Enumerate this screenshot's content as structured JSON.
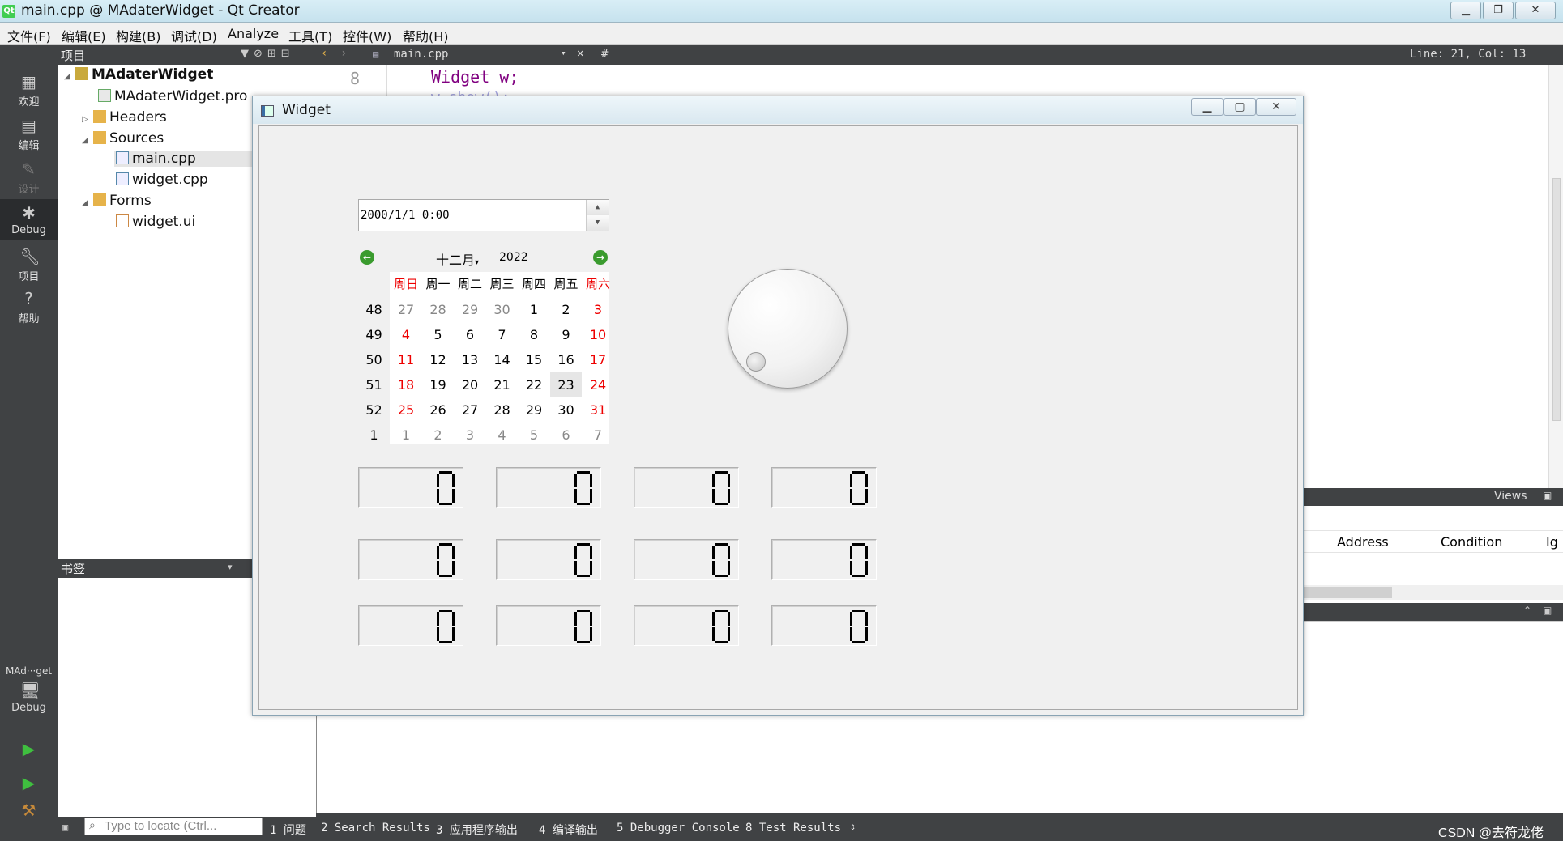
{
  "window": {
    "title": "main.cpp @ MAdaterWidget - Qt Creator",
    "app_icon": "qt-logo-icon"
  },
  "menubar": [
    "文件(F)",
    "编辑(E)",
    "构建(B)",
    "调试(D)",
    "Analyze",
    "工具(T)",
    "控件(W)",
    "帮助(H)"
  ],
  "modes": {
    "welcome": "欢迎",
    "edit": "编辑",
    "design": "设计",
    "debug": "Debug",
    "projects": "项目",
    "help": "帮助",
    "kit_name": "MAd···get",
    "kit_mode": "Debug"
  },
  "project_pane": {
    "header": "项目",
    "tree": [
      {
        "label": "MAdaterWidget",
        "bold": true
      },
      {
        "label": "MAdaterWidget.pro"
      },
      {
        "label": "Headers"
      },
      {
        "label": "Sources"
      },
      {
        "label": "main.cpp",
        "selected": true
      },
      {
        "label": "widget.cpp"
      },
      {
        "label": "Forms"
      },
      {
        "label": "widget.ui"
      }
    ]
  },
  "bookmarks": {
    "header": "书签"
  },
  "editor": {
    "file_tab": "main.cpp",
    "symbol": "#",
    "position": "Line: 21, Col: 13",
    "line_number": "8",
    "code_line": "Widget w;",
    "code_line_faded": "w.show();"
  },
  "debugger": {
    "views_label": "Views",
    "columns": [
      "Address",
      "Condition",
      "Ig"
    ]
  },
  "statusbar": {
    "locator_placeholder": "Type to locate (Ctrl...",
    "tabs": [
      "1 问题",
      "2 Search Results",
      "3 应用程序输出",
      "4 编译输出",
      "5 Debugger Console",
      "8 Test Results"
    ],
    "watermark": "CSDN @去符龙佬"
  },
  "widget": {
    "title": "Widget",
    "datetime": "2000/1/1 0:00",
    "calendar": {
      "month": "十二月",
      "year": "2022",
      "day_headers": [
        "周日",
        "周一",
        "周二",
        "周三",
        "周四",
        "周五",
        "周六"
      ],
      "weeks": [
        {
          "num": "48",
          "days": [
            "27",
            "28",
            "29",
            "30",
            "1",
            "2",
            "3"
          ]
        },
        {
          "num": "49",
          "days": [
            "4",
            "5",
            "6",
            "7",
            "8",
            "9",
            "10"
          ]
        },
        {
          "num": "50",
          "days": [
            "11",
            "12",
            "13",
            "14",
            "15",
            "16",
            "17"
          ]
        },
        {
          "num": "51",
          "days": [
            "18",
            "19",
            "20",
            "21",
            "22",
            "23",
            "24"
          ]
        },
        {
          "num": "52",
          "days": [
            "25",
            "26",
            "27",
            "28",
            "29",
            "30",
            "31"
          ]
        },
        {
          "num": "1",
          "days": [
            "1",
            "2",
            "3",
            "4",
            "5",
            "6",
            "7"
          ]
        }
      ],
      "selected_day": "23"
    },
    "dial_value": 0,
    "lcd_values": [
      "0",
      "0",
      "0",
      "0",
      "0",
      "0",
      "0",
      "0",
      "0",
      "0",
      "0",
      "0"
    ]
  },
  "colors": {
    "weekend": "#e00000",
    "qt_green": "#41cd52",
    "dark_panel": "#404244"
  }
}
